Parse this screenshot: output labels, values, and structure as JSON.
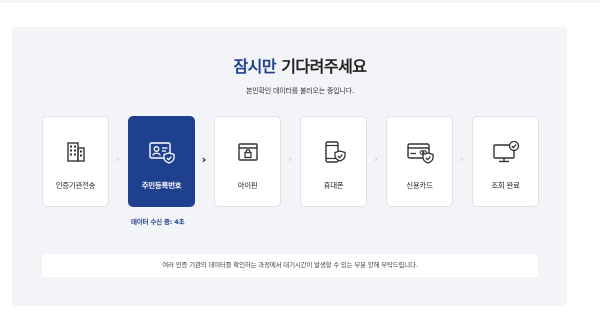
{
  "title": {
    "highlight": "잠시만",
    "rest": "기다려주세요"
  },
  "subtitle": "본인확인 데이터를 불러오는 중입니다.",
  "steps": [
    {
      "label": "인증기관전송",
      "icon": "building-icon",
      "active": false
    },
    {
      "label": "주민등록번호",
      "icon": "id-card-check-icon",
      "active": true
    },
    {
      "label": "아이핀",
      "icon": "browser-lock-icon",
      "active": false
    },
    {
      "label": "휴대폰",
      "icon": "phone-check-icon",
      "active": false
    },
    {
      "label": "신용카드",
      "icon": "credit-card-check-icon",
      "active": false
    },
    {
      "label": "조회 완료",
      "icon": "monitor-check-icon",
      "active": false
    }
  ],
  "status": "데이터 수신 중: 4초",
  "notice": "여러 인증 기관의 데이터를 확인하는 과정에서 대기시간이 발생할 수 있는 부분 양해 부탁드립니다.",
  "colors": {
    "accent": "#1f3f8f",
    "panel": "#f2f4f7",
    "card_border": "#dfe3e8"
  }
}
